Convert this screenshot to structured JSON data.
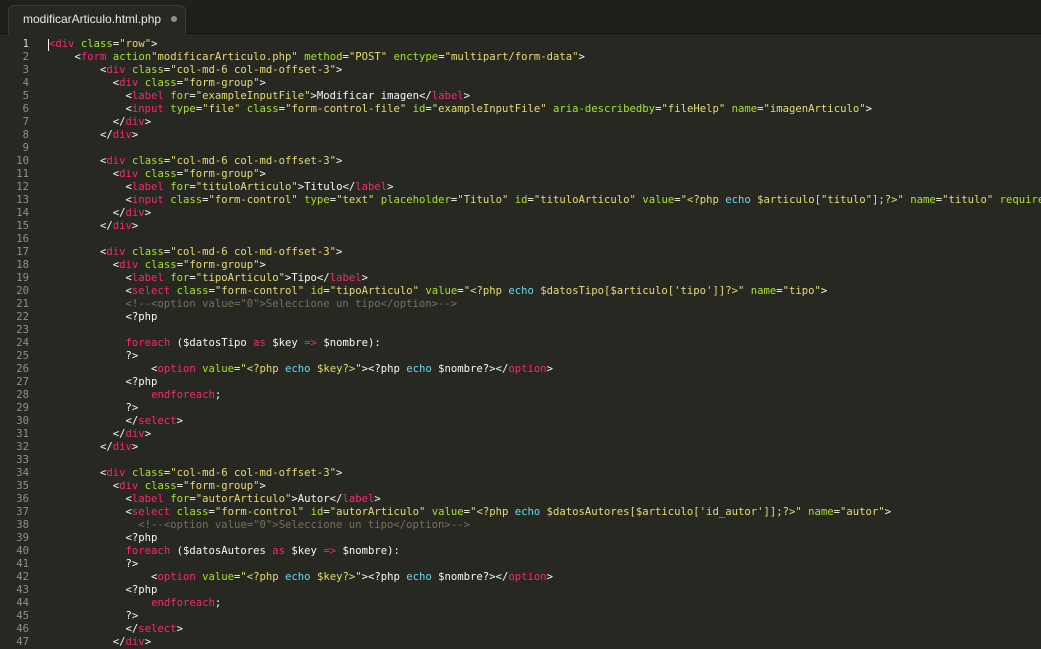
{
  "tab": {
    "title": "modificarArticulo.html.php",
    "state": "modified"
  },
  "current_line": 1,
  "lines": [
    [
      [
        "t",
        "<"
      ],
      [
        "t",
        "div"
      ],
      [
        "p",
        " "
      ],
      [
        "a",
        "class"
      ],
      [
        "p",
        "="
      ],
      [
        "s",
        "\"row\""
      ],
      [
        "p",
        ">"
      ]
    ],
    [
      [
        "p",
        "    "
      ],
      [
        "p",
        "<"
      ],
      [
        "t",
        "form"
      ],
      [
        "p",
        " "
      ],
      [
        "a",
        "action"
      ],
      [
        "s",
        "\"modificarArticulo.php\""
      ],
      [
        "p",
        " "
      ],
      [
        "a",
        "method"
      ],
      [
        "p",
        "="
      ],
      [
        "s",
        "\"POST\""
      ],
      [
        "p",
        " "
      ],
      [
        "a",
        "enctype"
      ],
      [
        "p",
        "="
      ],
      [
        "s",
        "\"multipart/form-data\""
      ],
      [
        "p",
        ">"
      ]
    ],
    [
      [
        "p",
        "        <"
      ],
      [
        "t",
        "div"
      ],
      [
        "p",
        " "
      ],
      [
        "a",
        "class"
      ],
      [
        "p",
        "="
      ],
      [
        "s",
        "\"col-md-6 col-md-offset-3\""
      ],
      [
        "p",
        ">"
      ]
    ],
    [
      [
        "p",
        "          <"
      ],
      [
        "t",
        "div"
      ],
      [
        "p",
        " "
      ],
      [
        "a",
        "class"
      ],
      [
        "p",
        "="
      ],
      [
        "s",
        "\"form-group\""
      ],
      [
        "p",
        ">"
      ]
    ],
    [
      [
        "p",
        "            <"
      ],
      [
        "t",
        "label"
      ],
      [
        "p",
        " "
      ],
      [
        "a",
        "for"
      ],
      [
        "p",
        "="
      ],
      [
        "s",
        "\"exampleInputFile\""
      ],
      [
        "p",
        ">Modificar imagen</"
      ],
      [
        "t",
        "label"
      ],
      [
        "p",
        ">"
      ]
    ],
    [
      [
        "p",
        "            <"
      ],
      [
        "t",
        "input"
      ],
      [
        "p",
        " "
      ],
      [
        "a",
        "type"
      ],
      [
        "p",
        "="
      ],
      [
        "s",
        "\"file\""
      ],
      [
        "p",
        " "
      ],
      [
        "a",
        "class"
      ],
      [
        "p",
        "="
      ],
      [
        "s",
        "\"form-control-file\""
      ],
      [
        "p",
        " "
      ],
      [
        "a",
        "id"
      ],
      [
        "p",
        "="
      ],
      [
        "s",
        "\"exampleInputFile\""
      ],
      [
        "p",
        " "
      ],
      [
        "a",
        "aria-describedby"
      ],
      [
        "p",
        "="
      ],
      [
        "s",
        "\"fileHelp\""
      ],
      [
        "p",
        " "
      ],
      [
        "a",
        "name"
      ],
      [
        "p",
        "="
      ],
      [
        "s",
        "\"imagenArticulo\""
      ],
      [
        "p",
        ">"
      ]
    ],
    [
      [
        "p",
        "          </"
      ],
      [
        "t",
        "div"
      ],
      [
        "p",
        ">"
      ]
    ],
    [
      [
        "p",
        "        </"
      ],
      [
        "t",
        "div"
      ],
      [
        "p",
        ">"
      ]
    ],
    [],
    [
      [
        "p",
        "        <"
      ],
      [
        "t",
        "div"
      ],
      [
        "p",
        " "
      ],
      [
        "a",
        "class"
      ],
      [
        "p",
        "="
      ],
      [
        "s",
        "\"col-md-6 col-md-offset-3\""
      ],
      [
        "p",
        ">"
      ]
    ],
    [
      [
        "p",
        "          <"
      ],
      [
        "t",
        "div"
      ],
      [
        "p",
        " "
      ],
      [
        "a",
        "class"
      ],
      [
        "p",
        "="
      ],
      [
        "s",
        "\"form-group\""
      ],
      [
        "p",
        ">"
      ]
    ],
    [
      [
        "p",
        "            <"
      ],
      [
        "t",
        "label"
      ],
      [
        "p",
        " "
      ],
      [
        "a",
        "for"
      ],
      [
        "p",
        "="
      ],
      [
        "s",
        "\"tituloArticulo\""
      ],
      [
        "p",
        ">Titulo</"
      ],
      [
        "t",
        "label"
      ],
      [
        "p",
        ">"
      ]
    ],
    [
      [
        "p",
        "            <"
      ],
      [
        "t",
        "input"
      ],
      [
        "p",
        " "
      ],
      [
        "a",
        "class"
      ],
      [
        "p",
        "="
      ],
      [
        "s",
        "\"form-control\""
      ],
      [
        "p",
        " "
      ],
      [
        "a",
        "type"
      ],
      [
        "p",
        "="
      ],
      [
        "s",
        "\"text\""
      ],
      [
        "p",
        " "
      ],
      [
        "a",
        "placeholder"
      ],
      [
        "p",
        "="
      ],
      [
        "s",
        "\"Titulo\""
      ],
      [
        "p",
        " "
      ],
      [
        "a",
        "id"
      ],
      [
        "p",
        "="
      ],
      [
        "s",
        "\"tituloArticulo\""
      ],
      [
        "p",
        " "
      ],
      [
        "a",
        "value"
      ],
      [
        "p",
        "="
      ],
      [
        "s",
        "\"<?php "
      ],
      [
        "f",
        "echo"
      ],
      [
        "s",
        " $articulo[\"titulo\"];?>\""
      ],
      [
        "p",
        " "
      ],
      [
        "a",
        "name"
      ],
      [
        "p",
        "="
      ],
      [
        "s",
        "\"titulo\""
      ],
      [
        "p",
        " "
      ],
      [
        "a",
        "required"
      ],
      [
        "p",
        ">"
      ]
    ],
    [
      [
        "p",
        "          </"
      ],
      [
        "t",
        "div"
      ],
      [
        "p",
        ">"
      ]
    ],
    [
      [
        "p",
        "        </"
      ],
      [
        "t",
        "div"
      ],
      [
        "p",
        ">"
      ]
    ],
    [],
    [
      [
        "p",
        "        <"
      ],
      [
        "t",
        "div"
      ],
      [
        "p",
        " "
      ],
      [
        "a",
        "class"
      ],
      [
        "p",
        "="
      ],
      [
        "s",
        "\"col-md-6 col-md-offset-3\""
      ],
      [
        "p",
        ">"
      ]
    ],
    [
      [
        "p",
        "          <"
      ],
      [
        "t",
        "div"
      ],
      [
        "p",
        " "
      ],
      [
        "a",
        "class"
      ],
      [
        "p",
        "="
      ],
      [
        "s",
        "\"form-group\""
      ],
      [
        "p",
        ">"
      ]
    ],
    [
      [
        "p",
        "            <"
      ],
      [
        "t",
        "label"
      ],
      [
        "p",
        " "
      ],
      [
        "a",
        "for"
      ],
      [
        "p",
        "="
      ],
      [
        "s",
        "\"tipoArticulo\""
      ],
      [
        "p",
        ">Tipo</"
      ],
      [
        "t",
        "label"
      ],
      [
        "p",
        ">"
      ]
    ],
    [
      [
        "p",
        "            <"
      ],
      [
        "t",
        "select"
      ],
      [
        "p",
        " "
      ],
      [
        "a",
        "class"
      ],
      [
        "p",
        "="
      ],
      [
        "s",
        "\"form-control\""
      ],
      [
        "p",
        " "
      ],
      [
        "a",
        "id"
      ],
      [
        "p",
        "="
      ],
      [
        "s",
        "\"tipoArticulo\""
      ],
      [
        "p",
        " "
      ],
      [
        "a",
        "value"
      ],
      [
        "p",
        "="
      ],
      [
        "s",
        "\"<?php "
      ],
      [
        "f",
        "echo"
      ],
      [
        "s",
        " $datosTipo[$articulo['tipo']]?>\""
      ],
      [
        "p",
        " "
      ],
      [
        "a",
        "name"
      ],
      [
        "p",
        "="
      ],
      [
        "s",
        "\"tipo\""
      ],
      [
        "p",
        ">"
      ]
    ],
    [
      [
        "c",
        "            <!--<option value=\"0\">Seleccione un tipo</option>-->"
      ]
    ],
    [
      [
        "p",
        "            <?php"
      ]
    ],
    [],
    [
      [
        "p",
        "            "
      ],
      [
        "k",
        "foreach"
      ],
      [
        "p",
        " ($datosTipo "
      ],
      [
        "k",
        "as"
      ],
      [
        "p",
        " $key "
      ],
      [
        "k",
        "=>"
      ],
      [
        "p",
        " $nombre):"
      ]
    ],
    [
      [
        "p",
        "            ?>"
      ]
    ],
    [
      [
        "p",
        "                <"
      ],
      [
        "t",
        "option"
      ],
      [
        "p",
        " "
      ],
      [
        "a",
        "value"
      ],
      [
        "p",
        "="
      ],
      [
        "s",
        "\"<?php "
      ],
      [
        "f",
        "echo"
      ],
      [
        "s",
        " $key?>\""
      ],
      [
        "p",
        ">"
      ],
      [
        "p",
        "<?php "
      ],
      [
        "f",
        "echo"
      ],
      [
        "p",
        " $nombre?></"
      ],
      [
        "t",
        "option"
      ],
      [
        "p",
        ">"
      ]
    ],
    [
      [
        "p",
        "            <?php"
      ]
    ],
    [
      [
        "p",
        "                "
      ],
      [
        "k",
        "endforeach"
      ],
      [
        "p",
        ";"
      ]
    ],
    [
      [
        "p",
        "            ?>"
      ]
    ],
    [
      [
        "p",
        "            </"
      ],
      [
        "t",
        "select"
      ],
      [
        "p",
        ">"
      ]
    ],
    [
      [
        "p",
        "          </"
      ],
      [
        "t",
        "div"
      ],
      [
        "p",
        ">"
      ]
    ],
    [
      [
        "p",
        "        </"
      ],
      [
        "t",
        "div"
      ],
      [
        "p",
        ">"
      ]
    ],
    [],
    [
      [
        "p",
        "        <"
      ],
      [
        "t",
        "div"
      ],
      [
        "p",
        " "
      ],
      [
        "a",
        "class"
      ],
      [
        "p",
        "="
      ],
      [
        "s",
        "\"col-md-6 col-md-offset-3\""
      ],
      [
        "p",
        ">"
      ]
    ],
    [
      [
        "p",
        "          <"
      ],
      [
        "t",
        "div"
      ],
      [
        "p",
        " "
      ],
      [
        "a",
        "class"
      ],
      [
        "p",
        "="
      ],
      [
        "s",
        "\"form-group\""
      ],
      [
        "p",
        ">"
      ]
    ],
    [
      [
        "p",
        "            <"
      ],
      [
        "t",
        "label"
      ],
      [
        "p",
        " "
      ],
      [
        "a",
        "for"
      ],
      [
        "p",
        "="
      ],
      [
        "s",
        "\"autorArticulo\""
      ],
      [
        "p",
        ">Autor</"
      ],
      [
        "t",
        "label"
      ],
      [
        "p",
        ">"
      ]
    ],
    [
      [
        "p",
        "            <"
      ],
      [
        "t",
        "select"
      ],
      [
        "p",
        " "
      ],
      [
        "a",
        "class"
      ],
      [
        "p",
        "="
      ],
      [
        "s",
        "\"form-control\""
      ],
      [
        "p",
        " "
      ],
      [
        "a",
        "id"
      ],
      [
        "p",
        "="
      ],
      [
        "s",
        "\"autorArticulo\""
      ],
      [
        "p",
        " "
      ],
      [
        "a",
        "value"
      ],
      [
        "p",
        "="
      ],
      [
        "s",
        "\"<?php "
      ],
      [
        "f",
        "echo"
      ],
      [
        "s",
        " $datosAutores[$articulo['id_autor']];?>\""
      ],
      [
        "p",
        " "
      ],
      [
        "a",
        "name"
      ],
      [
        "p",
        "="
      ],
      [
        "s",
        "\"autor\""
      ],
      [
        "p",
        ">"
      ]
    ],
    [
      [
        "c",
        "              <!--<option value=\"0\">Seleccione un tipo</option>-->"
      ]
    ],
    [
      [
        "p",
        "            <?php"
      ]
    ],
    [
      [
        "p",
        "            "
      ],
      [
        "k",
        "foreach"
      ],
      [
        "p",
        " ($datosAutores "
      ],
      [
        "k",
        "as"
      ],
      [
        "p",
        " $key "
      ],
      [
        "k",
        "=>"
      ],
      [
        "p",
        " $nombre):"
      ]
    ],
    [
      [
        "p",
        "            ?>"
      ]
    ],
    [
      [
        "p",
        "                <"
      ],
      [
        "t",
        "option"
      ],
      [
        "p",
        " "
      ],
      [
        "a",
        "value"
      ],
      [
        "p",
        "="
      ],
      [
        "s",
        "\"<?php "
      ],
      [
        "f",
        "echo"
      ],
      [
        "s",
        " $key?>\""
      ],
      [
        "p",
        ">"
      ],
      [
        "p",
        "<?php "
      ],
      [
        "f",
        "echo"
      ],
      [
        "p",
        " $nombre?></"
      ],
      [
        "t",
        "option"
      ],
      [
        "p",
        ">"
      ]
    ],
    [
      [
        "p",
        "            <?php"
      ]
    ],
    [
      [
        "p",
        "                "
      ],
      [
        "k",
        "endforeach"
      ],
      [
        "p",
        ";"
      ]
    ],
    [
      [
        "p",
        "            ?>"
      ]
    ],
    [
      [
        "p",
        "            </"
      ],
      [
        "t",
        "select"
      ],
      [
        "p",
        ">"
      ]
    ],
    [
      [
        "p",
        "          </"
      ],
      [
        "t",
        "div"
      ],
      [
        "p",
        ">"
      ]
    ]
  ]
}
